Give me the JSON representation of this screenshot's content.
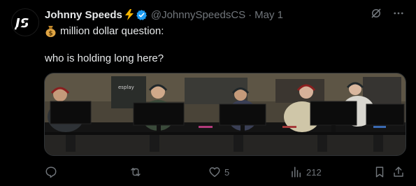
{
  "author": {
    "display_name": "Johnny Speeds",
    "handle": "@JohnnySpeedsCS",
    "separator": "·",
    "date": "May 1",
    "avatar_icon": "js-monogram-logo",
    "badge_icon": "lightning-bolt-emoji",
    "verified_icon": "verified-badge-icon",
    "verified_color": "#1d9bf0"
  },
  "tweet": {
    "emoji_icon": "money-bag-emoji",
    "line1": "million dollar question:",
    "line2": "who is holding long here?"
  },
  "media": {
    "description_icon": "esports-players-photo",
    "sponsor_text": "esplay"
  },
  "header_actions": {
    "grok_icon": "grok-icon",
    "more_icon": "more-dots-icon"
  },
  "actions": {
    "reply_count": "",
    "retweet_count": "",
    "like_count": "5",
    "views_count": "212"
  },
  "colors": {
    "background": "#000000",
    "text_primary": "#e7e9ea",
    "text_secondary": "#71767b",
    "accent": "#1d9bf0",
    "bolt": "#f7b500"
  }
}
